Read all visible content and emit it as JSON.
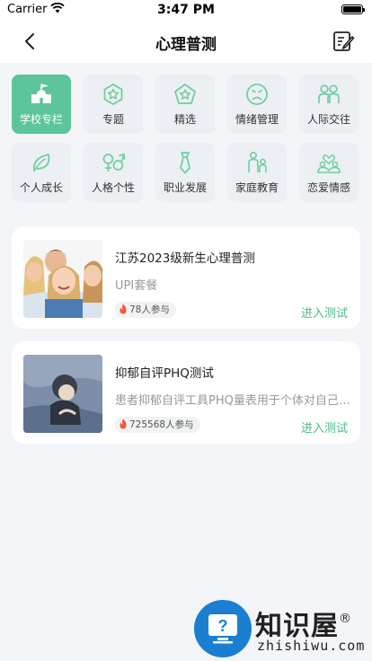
{
  "status_bar": {
    "carrier": "Carrier",
    "time": "3:47 PM"
  },
  "nav": {
    "title": "心理普测"
  },
  "categories": [
    {
      "label": "学校专栏",
      "icon": "school-icon",
      "active": true
    },
    {
      "label": "专题",
      "icon": "hexagon-star-icon"
    },
    {
      "label": "精选",
      "icon": "pentagon-star-icon"
    },
    {
      "label": "情绪管理",
      "icon": "sad-face-icon"
    },
    {
      "label": "人际交往",
      "icon": "people-icon"
    },
    {
      "label": "个人成长",
      "icon": "leaf-icon"
    },
    {
      "label": "人格个性",
      "icon": "gender-icon"
    },
    {
      "label": "职业发展",
      "icon": "tie-icon"
    },
    {
      "label": "家庭教育",
      "icon": "family-icon"
    },
    {
      "label": "恋爱情感",
      "icon": "couple-heart-icon"
    }
  ],
  "tests": [
    {
      "title": "江苏2023级新生心理普测",
      "subtitle": "UPI套餐",
      "participants": "78人参与",
      "action": "进入测试"
    },
    {
      "title": "抑郁自评PHQ测试",
      "subtitle": "患者抑郁自评工具PHQ量表用于个体对自己抑郁程度的评估",
      "participants": "725568人参与",
      "action": "进入测试"
    }
  ],
  "watermark": {
    "brand": "知识屋",
    "reg": "®",
    "domain": "zhishiwu.com"
  },
  "colors": {
    "accent": "#5cc69a",
    "action": "#48bd8a",
    "tile": "#eceff3",
    "background": "#f4f5f9"
  }
}
